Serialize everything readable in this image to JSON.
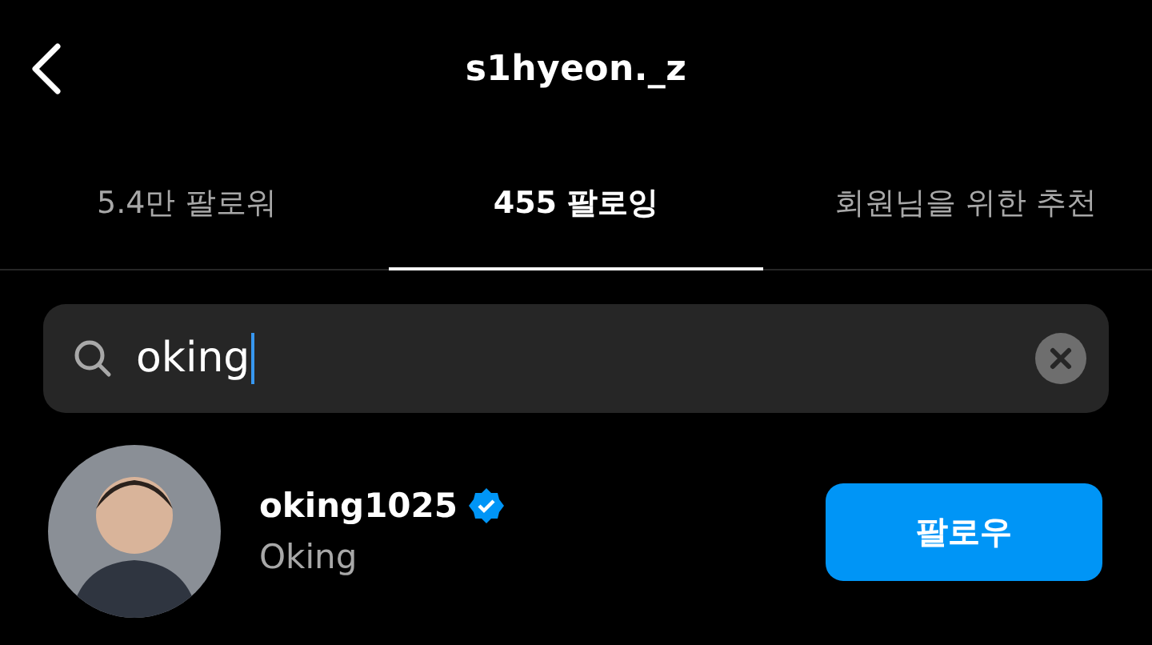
{
  "header": {
    "title": "s1hyeon._z"
  },
  "tabs": [
    {
      "label": "5.4만 팔로워",
      "selected": false
    },
    {
      "label": "455 팔로잉",
      "selected": true
    },
    {
      "label": "회원님을 위한 추천",
      "selected": false
    }
  ],
  "search": {
    "value": "oking"
  },
  "results": [
    {
      "username": "oking1025",
      "verified": true,
      "name": "Oking",
      "button": "팔로우"
    }
  ]
}
